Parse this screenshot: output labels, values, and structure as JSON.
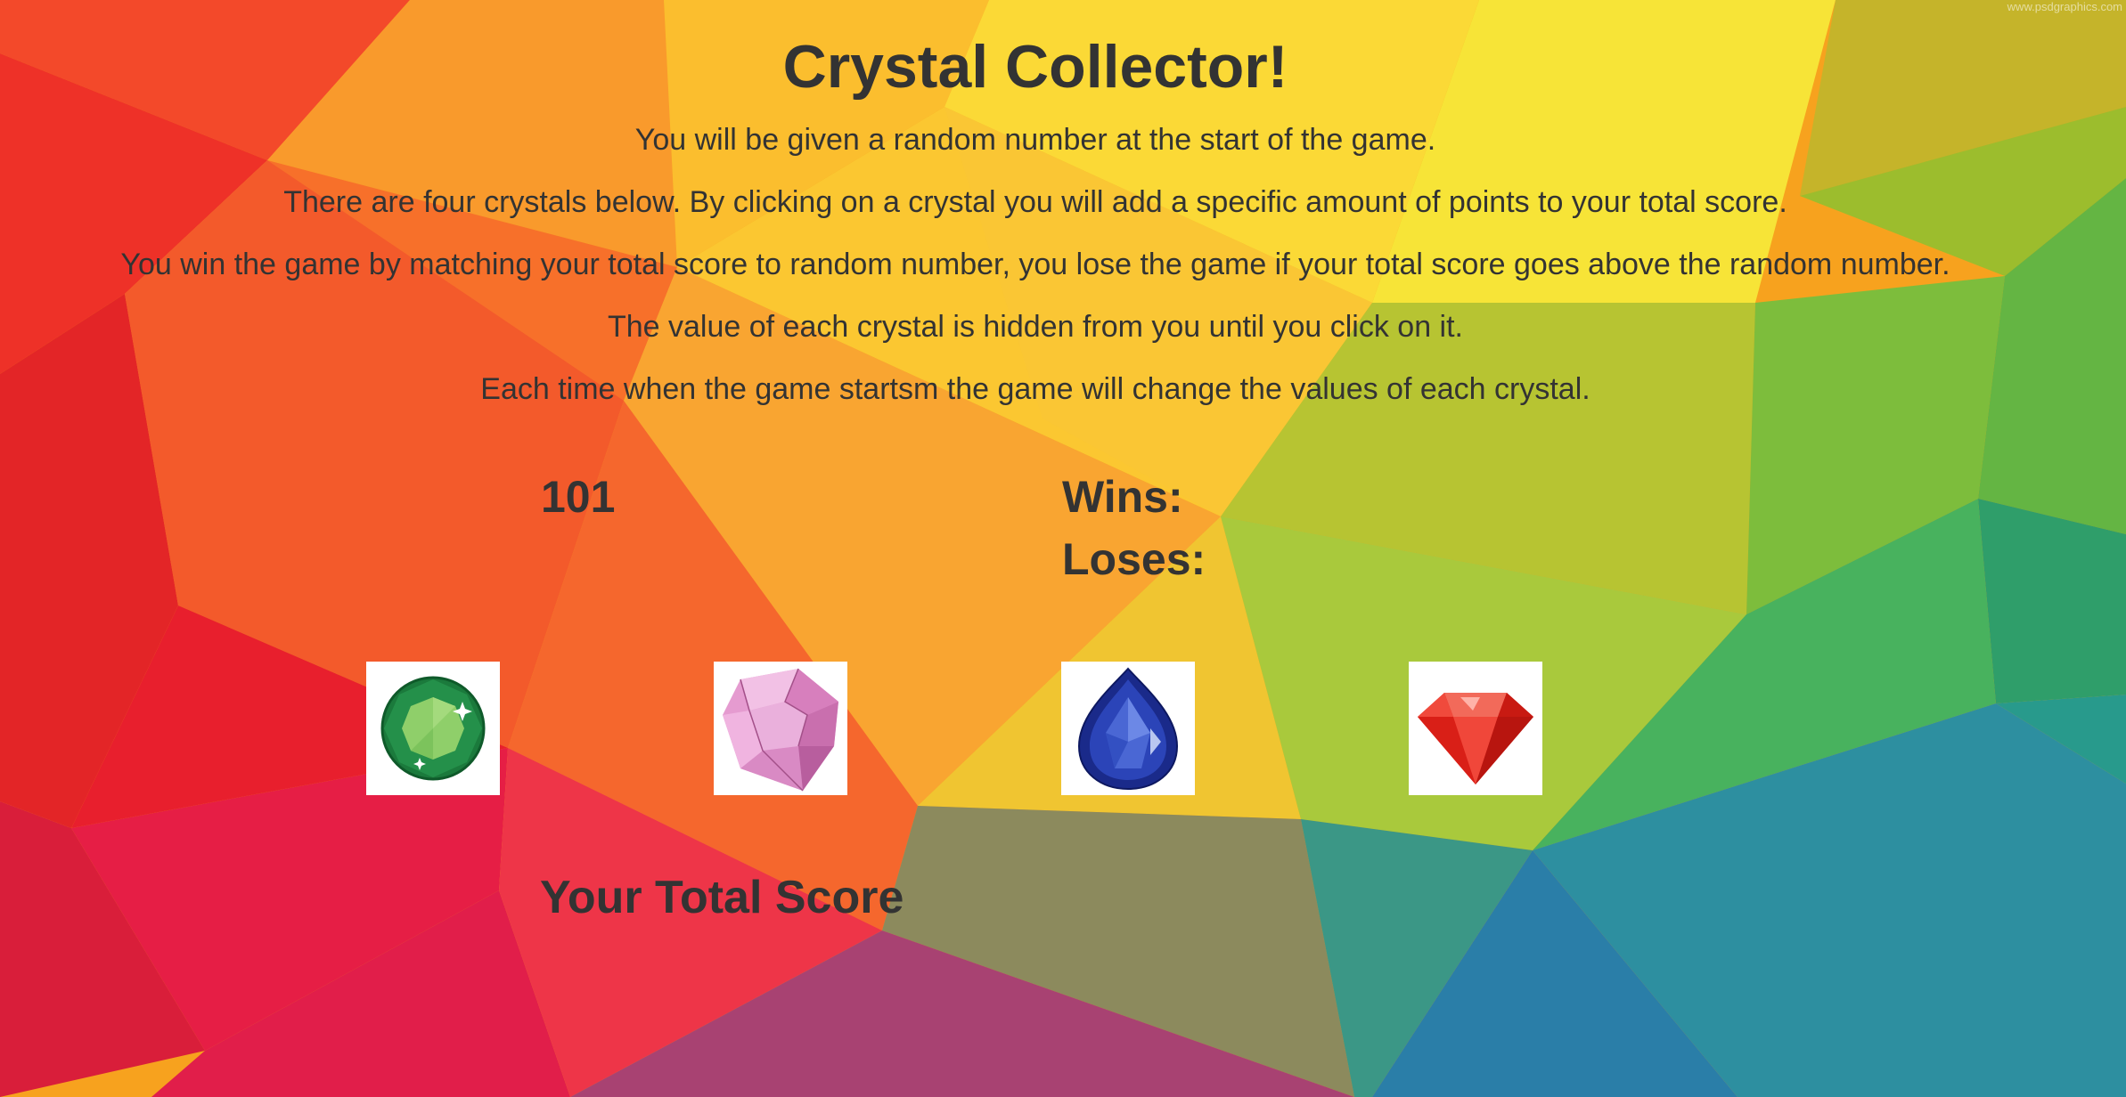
{
  "title": "Crystal Collector!",
  "instructions": [
    "You will be given a random number at the start of the game.",
    "There are four crystals below. By clicking on a crystal you will add a specific amount of points to your total score.",
    "You win the game by matching your total score to random number, you lose the game if your total score goes above the random number.",
    "The value of each crystal is hidden from you until you click on it.",
    "Each time when the game startsm the game will change the values of each crystal."
  ],
  "random_number": "101",
  "wins_label": "Wins:",
  "loses_label": "Loses:",
  "crystals": [
    {
      "icon": "green-emerald-crystal-icon",
      "color": "#1f8a45"
    },
    {
      "icon": "pink-diamond-crystal-icon",
      "color": "#e4a0cf"
    },
    {
      "icon": "blue-sapphire-crystal-icon",
      "color": "#1d2f8f"
    },
    {
      "icon": "red-ruby-crystal-icon",
      "color": "#e8261c"
    }
  ],
  "total_score_label": "Your Total Score",
  "watermark": "www.psdgraphics.com"
}
